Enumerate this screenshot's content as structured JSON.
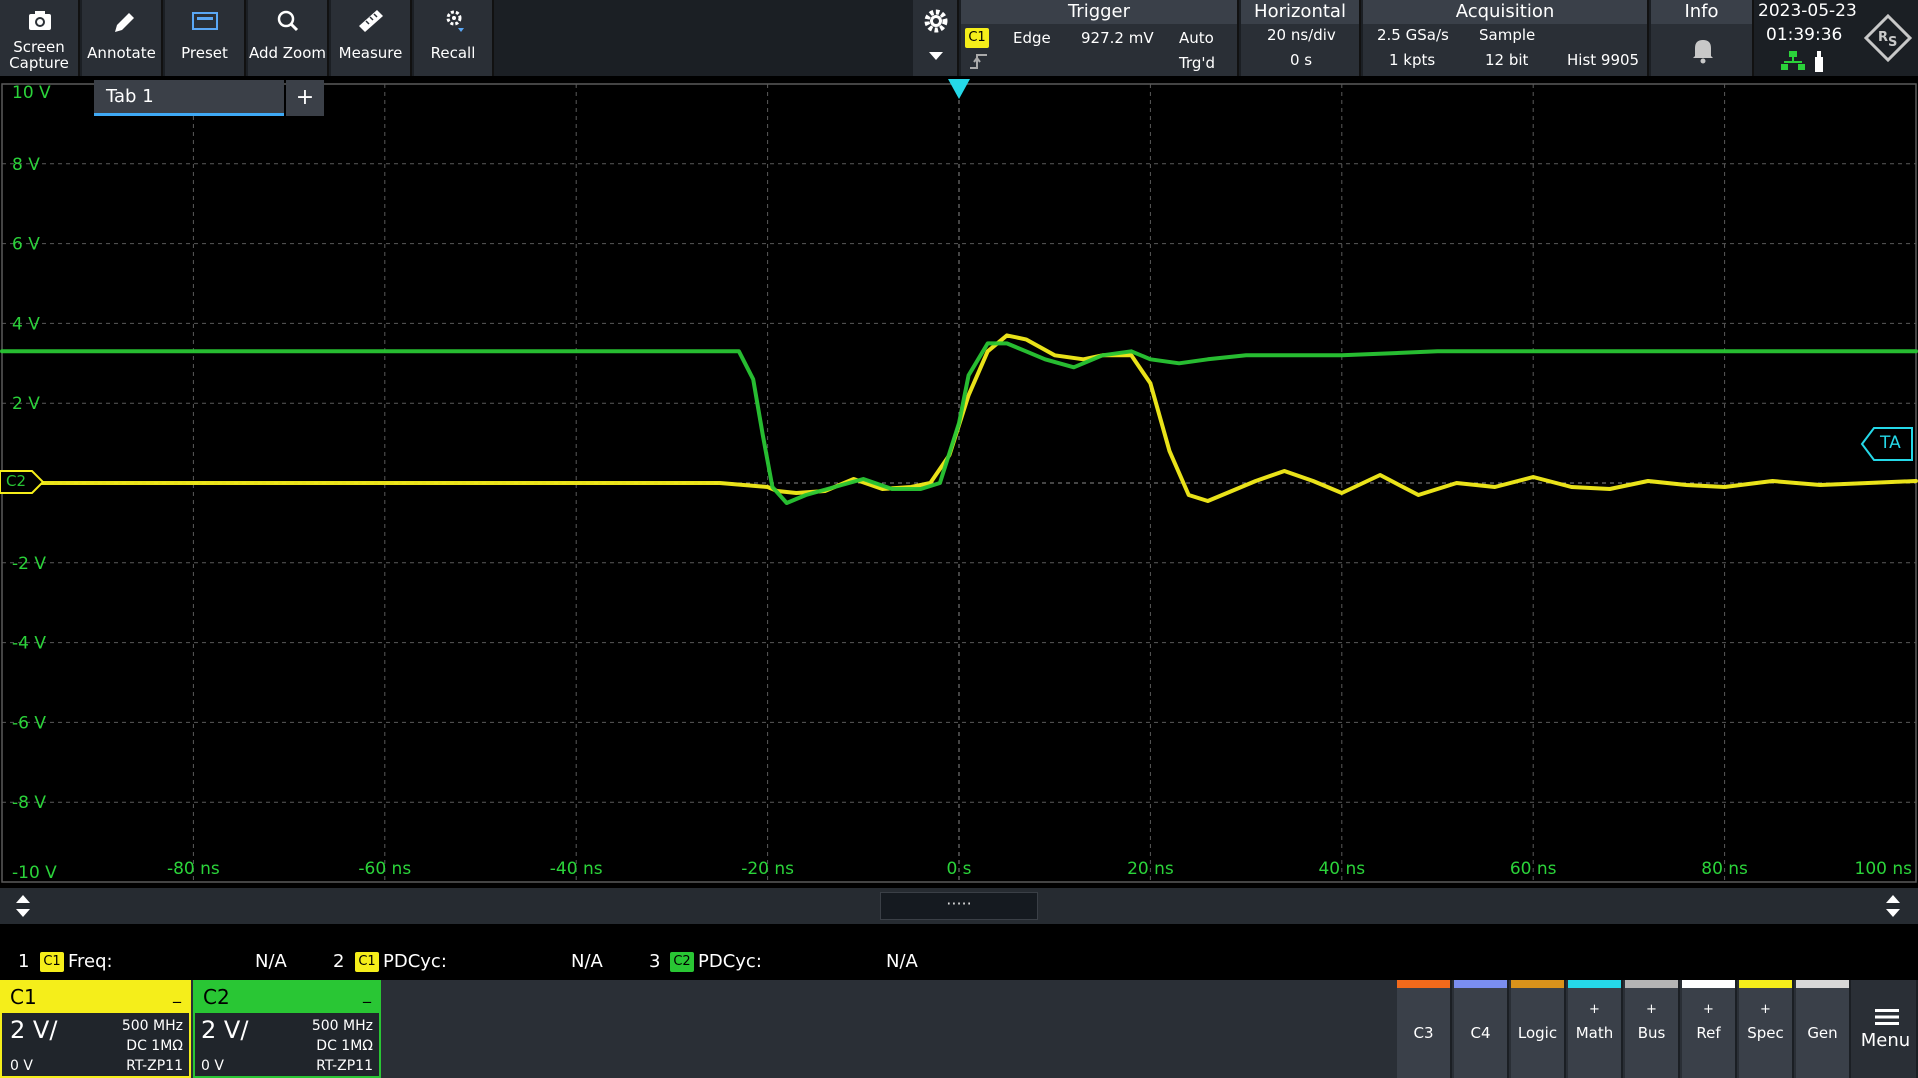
{
  "toolbar": {
    "screen_capture": [
      "Screen",
      "Capture"
    ],
    "annotate": "Annotate",
    "preset": "Preset",
    "add_zoom": "Add Zoom",
    "measure": "Measure",
    "recall": "Recall"
  },
  "trigger": {
    "title": "Trigger",
    "source": "C1",
    "type": "Edge",
    "level": "927.2 mV",
    "mode": "Auto",
    "state": "Trg'd"
  },
  "horizontal": {
    "title": "Horizontal",
    "scale": "20 ns/div",
    "position": "0 s"
  },
  "acquisition": {
    "title": "Acquisition",
    "rate": "2.5 GSa/s",
    "mode": "Sample",
    "points": "1 kpts",
    "resolution": "12 bit",
    "hist": "Hist 9905"
  },
  "info": {
    "title": "Info"
  },
  "clock": {
    "date": "2023-05-23",
    "time": "01:39:36"
  },
  "tabs": {
    "tab1": "Tab 1",
    "add": "+"
  },
  "markers": {
    "ta": "TA",
    "c2": "C2"
  },
  "chart_data": {
    "type": "line",
    "ylabels": [
      "10 V",
      "8 V",
      "6 V",
      "4 V",
      "2 V",
      "",
      "-2 V",
      "-4 V",
      "-6 V",
      "-8 V",
      "-10 V"
    ],
    "xlabels": [
      "-80 ns",
      "-60 ns",
      "-40 ns",
      "-20 ns",
      "0 s",
      "20 ns",
      "40 ns",
      "60 ns",
      "80 ns",
      "100 ns"
    ],
    "xlim": [
      -100,
      100
    ],
    "ylim": [
      -10,
      10
    ],
    "series": [
      {
        "color": "#f5ee1a",
        "x": [
          -100,
          -25,
          -20,
          -19,
          -17,
          -14,
          -11,
          -8,
          -5,
          -3,
          -1,
          1,
          3,
          5,
          7,
          10,
          13,
          15,
          18,
          20,
          22,
          24,
          26,
          28,
          31,
          34,
          37,
          40,
          44,
          48,
          52,
          56,
          60,
          64,
          68,
          72,
          76,
          80,
          85,
          90,
          95,
          100
        ],
        "y": [
          0,
          0,
          -0.1,
          -0.2,
          -0.25,
          -0.2,
          0.1,
          -0.15,
          -0.1,
          0,
          0.7,
          2.2,
          3.3,
          3.7,
          3.6,
          3.2,
          3.1,
          3.2,
          3.2,
          2.5,
          0.8,
          -0.3,
          -0.45,
          -0.25,
          0.05,
          0.3,
          0.05,
          -0.25,
          0.2,
          -0.3,
          0.0,
          -0.1,
          0.15,
          -0.1,
          -0.15,
          0.05,
          -0.05,
          -0.1,
          0.05,
          -0.05,
          0.0,
          0.05
        ]
      },
      {
        "color": "#29c634",
        "x": [
          -100,
          -23,
          -21.5,
          -20.5,
          -19.5,
          -18,
          -16,
          -13,
          -10,
          -7,
          -4,
          -2,
          0,
          1,
          3,
          5,
          7,
          9,
          12,
          15,
          18,
          20,
          23,
          26,
          30,
          35,
          40,
          50,
          60,
          70,
          80,
          90,
          100
        ],
        "y": [
          3.3,
          3.3,
          2.6,
          1.2,
          -0.1,
          -0.5,
          -0.3,
          -0.1,
          0.1,
          -0.15,
          -0.15,
          0.0,
          1.5,
          2.7,
          3.5,
          3.5,
          3.3,
          3.1,
          2.9,
          3.2,
          3.3,
          3.1,
          3.0,
          3.1,
          3.2,
          3.2,
          3.2,
          3.3,
          3.3,
          3.3,
          3.3,
          3.3,
          3.3
        ]
      }
    ]
  },
  "measurements": [
    {
      "index": "1",
      "source": "C1",
      "source_color": "#f5ee1a",
      "label": "Freq:",
      "value": "N/A"
    },
    {
      "index": "2",
      "source": "C1",
      "source_color": "#f5ee1a",
      "label": "PDCyc:",
      "value": "N/A"
    },
    {
      "index": "3",
      "source": "C2",
      "source_color": "#29c634",
      "label": "PDCyc:",
      "value": "N/A"
    }
  ],
  "channels": [
    {
      "name": "C1",
      "scale": "2 V/",
      "bandwidth": "500 MHz",
      "coupling": "DC 1MΩ",
      "offset": "0 V",
      "probe": "RT-ZP11",
      "color": "#f5ee1a"
    },
    {
      "name": "C2",
      "scale": "2 V/",
      "bandwidth": "500 MHz",
      "coupling": "DC 1MΩ",
      "offset": "0 V",
      "probe": "RT-ZP11",
      "color": "#29c634"
    }
  ],
  "bottom_buttons": [
    {
      "label": "C3",
      "plus": "",
      "color": "#f26a1b"
    },
    {
      "label": "C4",
      "plus": "",
      "color": "#7a8ef0"
    },
    {
      "label": "Logic",
      "plus": "",
      "color": "#d9921b"
    },
    {
      "label": "Math",
      "plus": "+",
      "color": "#25d8e8"
    },
    {
      "label": "Bus",
      "plus": "+",
      "color": "#b4b4b4"
    },
    {
      "label": "Ref",
      "plus": "+",
      "color": "#ffffff"
    },
    {
      "label": "Spec",
      "plus": "+",
      "color": "#f5ee1a"
    },
    {
      "label": "Gen",
      "plus": "",
      "color": "#d8d8d8"
    }
  ],
  "menu": "Menu"
}
